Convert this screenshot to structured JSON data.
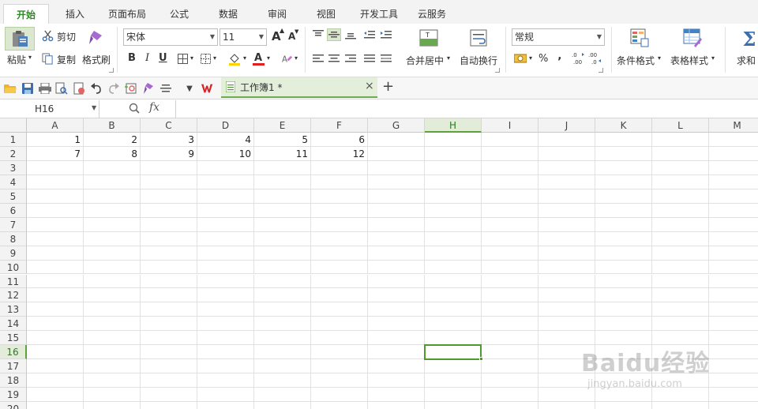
{
  "menu": {
    "tabs": [
      {
        "label": "开始",
        "active": true
      },
      {
        "label": "插入"
      },
      {
        "label": "页面布局"
      },
      {
        "label": "公式"
      },
      {
        "label": "数据"
      },
      {
        "label": "审阅"
      },
      {
        "label": "视图"
      },
      {
        "label": "开发工具"
      },
      {
        "label": "云服务"
      }
    ]
  },
  "ribbon": {
    "paste": "粘贴",
    "cut": "剪切",
    "copy": "复制",
    "format_painter": "格式刷",
    "font_name": "宋体",
    "font_size": "11",
    "merge_center": "合并居中",
    "wrap_text": "自动换行",
    "number_format": "常规",
    "percent": "%",
    "thousands": "‚",
    "cond_format": "条件格式",
    "table_style": "表格样式",
    "sum": "求和",
    "bold": "B",
    "italic": "I",
    "underline": "U",
    "font_color_letter": "A",
    "font_grow": "A",
    "font_shrink": "A",
    "colors": {
      "accent": "#2f8a25",
      "font_color": "#e02020",
      "fill_color": "#ffd200"
    }
  },
  "quickbar": {
    "doc_title": "工作簿1 *",
    "close": "×",
    "new_tab": "+"
  },
  "formula": {
    "name_box": "H16",
    "fx": "fx",
    "value": ""
  },
  "sheet": {
    "columns": [
      "A",
      "B",
      "C",
      "D",
      "E",
      "F",
      "G",
      "H",
      "I",
      "J",
      "K",
      "L",
      "M"
    ],
    "selected_column": "H",
    "rows": [
      "1",
      "2",
      "3",
      "4",
      "5",
      "6",
      "7",
      "8",
      "9",
      "10",
      "11",
      "12",
      "13",
      "14",
      "15",
      "16",
      "17",
      "18",
      "19",
      "20"
    ],
    "selected_row": "16",
    "cells": [
      [
        "1",
        "2",
        "3",
        "4",
        "5",
        "6"
      ],
      [
        "7",
        "8",
        "9",
        "10",
        "11",
        "12"
      ]
    ],
    "active_cell": "H16"
  },
  "watermark": {
    "brand": "Baidu经验",
    "url": "jingyan.baidu.com"
  }
}
